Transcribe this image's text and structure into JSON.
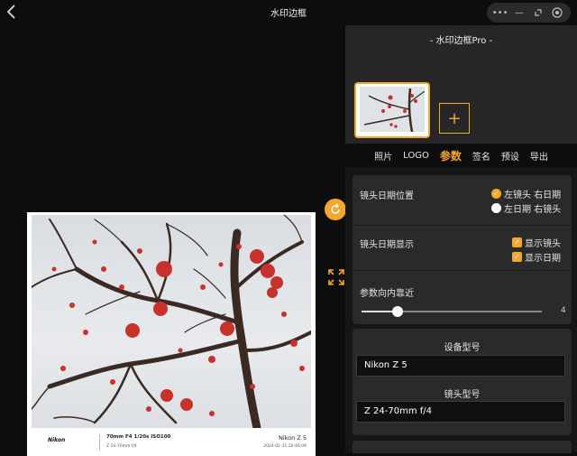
{
  "window": {
    "title": "水印边框",
    "back_icon": "chevron-left-icon"
  },
  "window_controls": [
    "more-icon",
    "minimize-icon",
    "restore-icon",
    "close-circle-icon"
  ],
  "brand": "- 水印边框Pro -",
  "tabs": [
    {
      "label": "照片",
      "active": false
    },
    {
      "label": "LOGO",
      "active": false
    },
    {
      "label": "参数",
      "active": true
    },
    {
      "label": "签名",
      "active": false
    },
    {
      "label": "预设",
      "active": false
    },
    {
      "label": "导出",
      "active": false
    }
  ],
  "lens_date_position": {
    "label": "镜头日期位置",
    "options": [
      {
        "label": "左镜头 右日期",
        "selected": true
      },
      {
        "label": "左日期 右镜头",
        "selected": false
      }
    ]
  },
  "lens_date_display": {
    "label": "镜头日期显示",
    "options": [
      {
        "label": "显示镜头",
        "checked": true
      },
      {
        "label": "显示日期",
        "checked": true
      }
    ]
  },
  "inward_offset": {
    "label": "参数向内靠近",
    "value": "4",
    "fraction": 0.2
  },
  "device_model": {
    "label": "设备型号",
    "value": "Nikon Z 5"
  },
  "lens_model": {
    "label": "镜头型号",
    "value": "Z 24-70mm f/4"
  },
  "watermark": {
    "logo": "Nikon",
    "params": "70mm F4 1/20s ISO100",
    "lens": "Z 24-70mm f/4",
    "model": "Nikon Z 5",
    "date": "2024-01-31 20:46:09"
  },
  "colors": {
    "accent": "#f3a82d",
    "panel": "#2a2a2a",
    "background": "#0d0d0d"
  }
}
